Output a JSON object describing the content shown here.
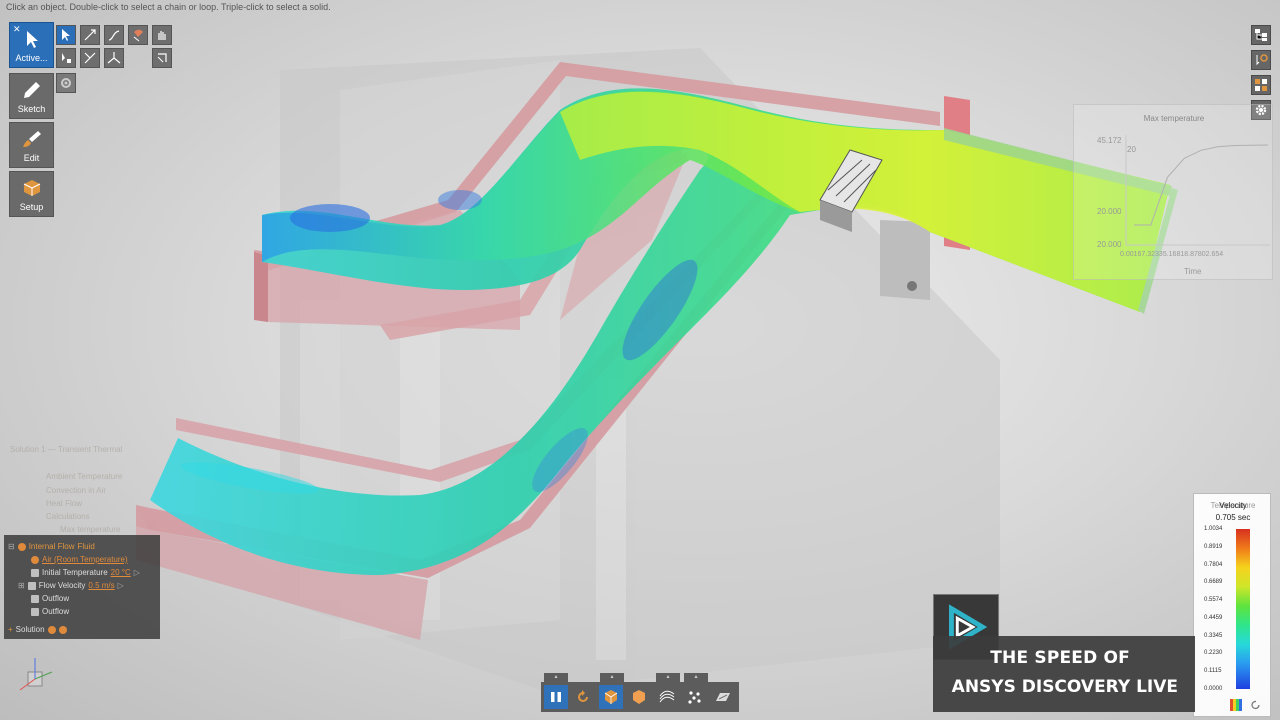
{
  "status_hint": "Click an object.  Double-click to select a chain or loop.  Triple-click to select a solid.",
  "tools": {
    "active_label": "Active...",
    "sketch_label": "Sketch",
    "edit_label": "Edit",
    "setup_label": "Setup"
  },
  "chart": {
    "title": "Max temperature",
    "y_ticks": [
      "45.172",
      "20",
      "20.000",
      "20.000"
    ],
    "x_ticks": "0.00167.32335.16818.87802.654",
    "x_label": "Time"
  },
  "chart_data": {
    "type": "line",
    "title": "Max temperature",
    "xlabel": "Time",
    "ylabel": "",
    "series": [
      {
        "values": [
          20,
          20,
          35,
          41,
          43.5,
          44.6,
          45,
          45.1,
          45.17
        ]
      }
    ]
  },
  "tree_ghost": {
    "header": "Solution 1 — Transient Thermal",
    "items": [
      "Ambient Temperature",
      "Convection in Air",
      "Heat Flow",
      "Calculations",
      "Max temperature"
    ]
  },
  "tree": {
    "header_name": "Internal Flow",
    "header_type": "Fluid",
    "material": "Air (Room Temperature)",
    "initial_temp_label": "Initial Temperature",
    "initial_temp_value": "20 °C",
    "flow_velocity_label": "Flow Velocity",
    "flow_velocity_value": "0.5 m/s",
    "outflow_1": "Outflow",
    "outflow_2": "Outflow",
    "solution_label": "Solution"
  },
  "legend": {
    "title_back": "Temperature",
    "title": "Velocity",
    "time": "0.705 sec",
    "values": [
      "1.0034",
      "0.8919",
      "0.7804",
      "0.6689",
      "0.5574",
      "0.4459",
      "0.3345",
      "0.2230",
      "0.1115",
      "0.0000"
    ]
  },
  "brand": {
    "line1": "THE SPEED OF",
    "line2": "ANSYS DISCOVERY LIVE"
  },
  "colors": {
    "accent_blue": "#2a6fb7",
    "highlight_orange": "#e08a3c"
  }
}
